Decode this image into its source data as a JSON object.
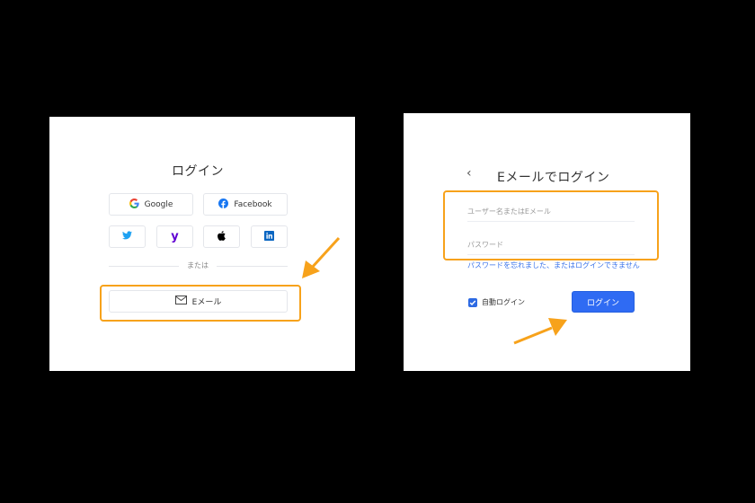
{
  "left_panel": {
    "title": "ログイン",
    "social_buttons": [
      {
        "name": "google",
        "label": "Google",
        "icon": "google-icon"
      },
      {
        "name": "facebook",
        "label": "Facebook",
        "icon": "facebook-icon"
      },
      {
        "name": "twitter",
        "label": "",
        "icon": "twitter-icon"
      },
      {
        "name": "yahoo",
        "label": "",
        "icon": "yahoo-icon"
      },
      {
        "name": "apple",
        "label": "",
        "icon": "apple-icon"
      },
      {
        "name": "linkedin",
        "label": "",
        "icon": "linkedin-icon"
      }
    ],
    "divider_text": "または",
    "email_button_label": "Eメール"
  },
  "right_panel": {
    "back_icon": "‹",
    "title": "Eメールでログイン",
    "username_placeholder": "ユーザー名またはEメール",
    "password_placeholder": "パスワード",
    "forgot_link": "パスワードを忘れました、またはログインできません",
    "auto_login_label": "自動ログイン",
    "auto_login_checked": true,
    "login_button_label": "ログイン"
  },
  "colors": {
    "highlight": "#f7a21b",
    "primary": "#2f6bf3",
    "link": "#3a73ea"
  }
}
